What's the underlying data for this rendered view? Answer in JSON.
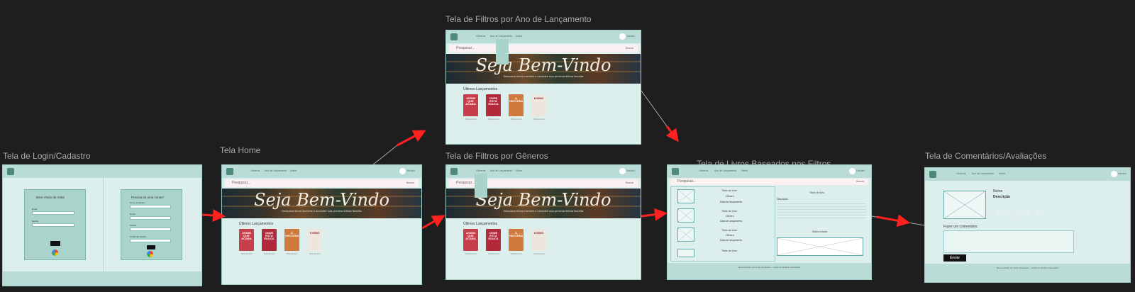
{
  "frames": [
    {
      "id": "login",
      "label": "Tela de Login/Cadastro"
    },
    {
      "id": "home",
      "label": "Tela Home"
    },
    {
      "id": "filtros-ano",
      "label": "Tela de Filtros por Ano de Lançamento"
    },
    {
      "id": "filtros-generos",
      "label": "Tela de Filtros por Gêneros"
    },
    {
      "id": "livros-filtros",
      "label": "Tela de Livros Baseados nos Filtros"
    },
    {
      "id": "comentarios",
      "label": "Tela de Comentários/Avaliações"
    }
  ],
  "nav": {
    "item1": "Gêneros",
    "item2": "Ano de Lançamento",
    "item3": "Sobre",
    "user": "Usuário"
  },
  "search": {
    "placeholder": "Pesquisar...",
    "button": "Buscar"
  },
  "hero": {
    "title": "Seja Bem-Vindo",
    "subtitle": "Descubra livros incríveis e encontre sua próxima leitura favorita"
  },
  "section": {
    "releases": "Últimos Lançamentos"
  },
  "books": [
    {
      "title": "ASSIM QUE ACABA",
      "color": "#c73f4a"
    },
    {
      "title": "ONDE ESTÁ EDUCA",
      "color": "#b3283a"
    },
    {
      "title": "A HISTÓRIA",
      "color": "#d17a3d"
    },
    {
      "title": "it KING",
      "color": "#ece6dd"
    }
  ],
  "book_caption": "Título do Livro",
  "login": {
    "left_title": "Bem-Vindo de Volta",
    "right_title": "Precisa de uma conta?",
    "email": "Email",
    "senha": "Senha",
    "confirm": "Confirmar Senha",
    "nome": "Nome completo",
    "enter": "Entrar",
    "cadastrar": "Criar"
  },
  "filter_list": {
    "item_title": "Título do Livro",
    "item_genre": "Gênero",
    "item_date": "Data de lançamento",
    "detail_title": "Título do livro",
    "detail_sub": "Descrição",
    "detail_author": "Sobre o Autor"
  },
  "comments": {
    "name": "Nome",
    "desc": "Descrição",
    "label": "Fazer um comentário:",
    "send": "Enviar"
  },
  "footer_text": "Desenvolvido por livros populares — todos os direitos reservados"
}
